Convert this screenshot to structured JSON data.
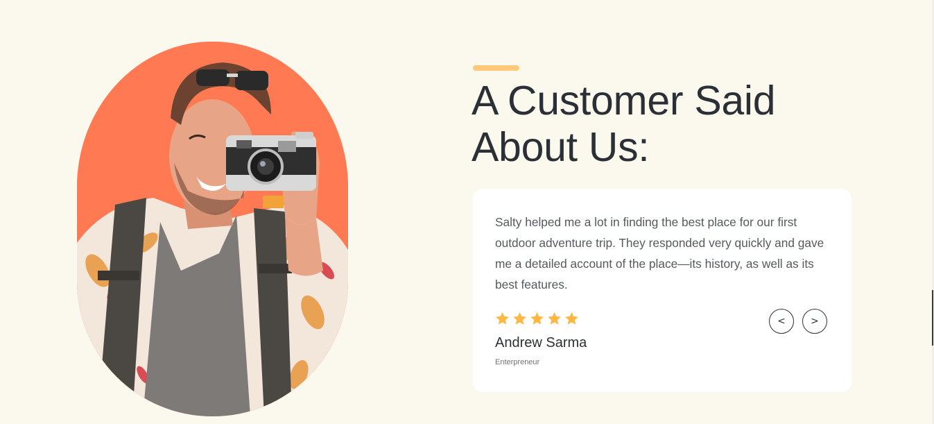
{
  "section": {
    "heading": "A Customer Said About Us:"
  },
  "testimonial": {
    "quote": "Salty helped me a lot in finding the best place for our first outdoor adventure trip. They responded very quickly and gave me a detailed account of the place—its history, as well as its best features.",
    "rating": 5,
    "rating_max": 5,
    "name": "Andrew Sarma",
    "role": "Enterpreneur"
  },
  "navigation": {
    "prev_label": "<",
    "next_label": ">"
  },
  "image": {
    "subject": "man with sunglasses on head taking photo with vintage camera"
  },
  "colors": {
    "background": "#fbf8ee",
    "photo_backdrop": "#ff7a52",
    "accent_bar": "#ffc87a",
    "star": "#ffb743",
    "heading": "#2b3036",
    "card": "#ffffff"
  }
}
